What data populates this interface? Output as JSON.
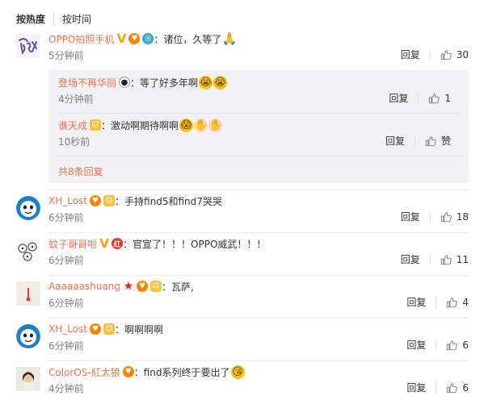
{
  "tabs": {
    "hot": "按热度",
    "time": "按时间"
  },
  "common": {
    "reply": "回复",
    "colon": "："
  },
  "main": {
    "name": "OPPO拍照手机",
    "text": "诸位，久等了",
    "time": "5分钟前",
    "likes": "30",
    "replies": [
      {
        "name": "登场不再华丽",
        "text": "等了好多年啊",
        "time": "4分钟前",
        "likes": "1"
      },
      {
        "name": "谯天成",
        "text": "激动啊期待啊啊",
        "time": "10秒前",
        "likes": "赞"
      }
    ],
    "more": "共8条回复"
  },
  "comments": [
    {
      "name": "XH_Lost",
      "text": "手持find5和find7哭哭",
      "time": "6分钟前",
      "likes": "18"
    },
    {
      "name": "蚊子哥哥啦",
      "text": "官宣了！！！OPPO威武！！！",
      "time": "6分钟前",
      "likes": "11"
    },
    {
      "name": "Aaaaaashuang",
      "text": "瓦萨,",
      "time": "6分钟前",
      "likes": "4"
    },
    {
      "name": "XH_Lost",
      "text": "啊啊啊啊",
      "time": "6分钟前",
      "likes": "6"
    },
    {
      "name": "ColorOS-紅太狼",
      "text": "find系列终于要出了",
      "time": "4分钟前",
      "likes": "6"
    }
  ],
  "colors": {
    "username": "#eb7350",
    "time": "#808080",
    "subbox": "#f2f2f5"
  }
}
